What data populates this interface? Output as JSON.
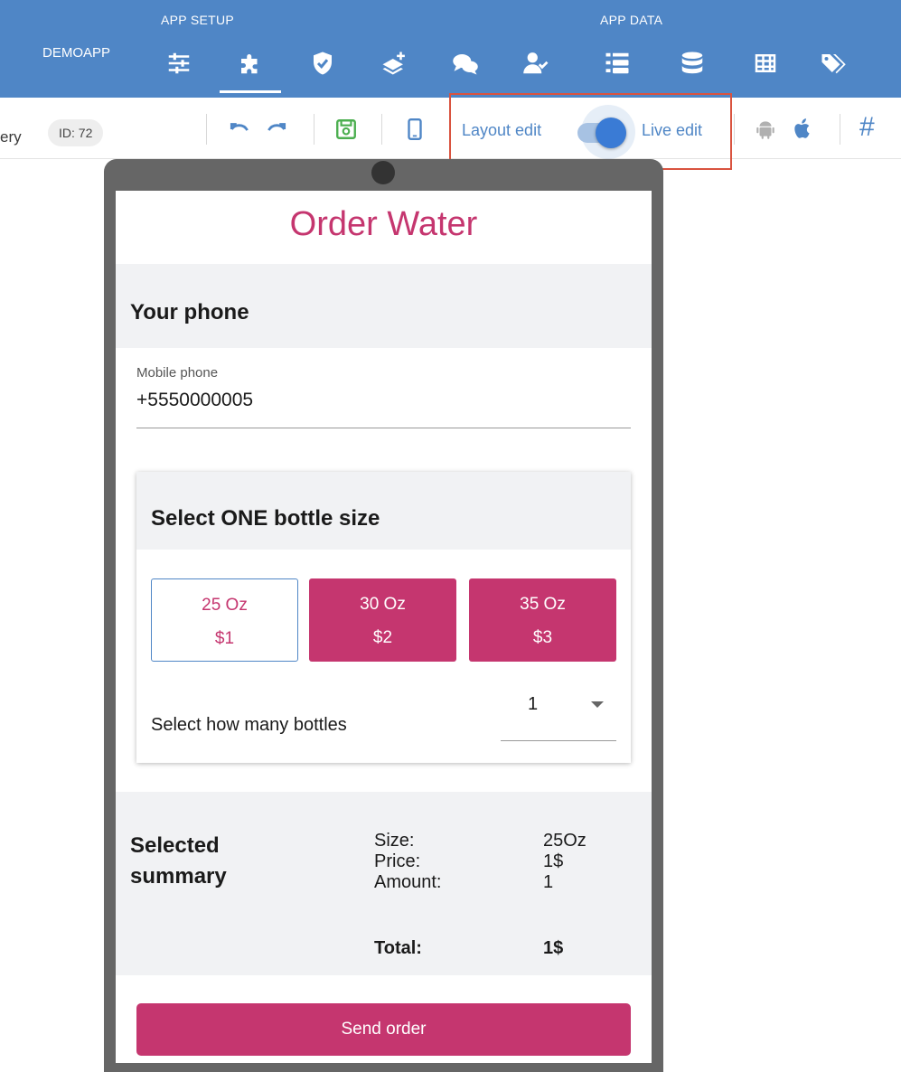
{
  "topbar": {
    "app_name": "DEMOAPP",
    "section_setup": "APP SETUP",
    "section_data": "APP DATA",
    "background_color": "#4f86c6",
    "icons": [
      "sliders-icon",
      "puzzle-icon",
      "shield-check-icon",
      "layers-add-icon",
      "chat-icon",
      "user-check-icon",
      "list-icon",
      "database-icon",
      "table-icon",
      "tags-icon"
    ],
    "active_icon": "puzzle-icon"
  },
  "toolbar": {
    "crumb": "ery",
    "id_badge": "ID: 72",
    "layout_edit_label": "Layout edit",
    "live_edit_label": "Live edit",
    "mode": "Live edit",
    "hash_label": "#",
    "icons": [
      "undo-icon",
      "redo-icon",
      "save-icon",
      "phone-preview-icon",
      "android-icon",
      "apple-icon"
    ]
  },
  "app": {
    "title": "Order Water",
    "accent_color": "#c5366f",
    "phone_section": {
      "heading": "Your phone",
      "field_label": "Mobile phone",
      "field_value": "+5550000005"
    },
    "bottle_card": {
      "heading": "Select ONE bottle size",
      "options": [
        {
          "size": "25 Oz",
          "price": "$1",
          "selected": true
        },
        {
          "size": "30 Oz",
          "price": "$2",
          "selected": false
        },
        {
          "size": "35 Oz",
          "price": "$3",
          "selected": false
        }
      ],
      "quantity_label": "Select how many bottles",
      "quantity_value": "1"
    },
    "summary": {
      "heading": "Selected summary",
      "rows": [
        {
          "label": "Size:",
          "value": "25Oz"
        },
        {
          "label": "Price:",
          "value": "1$"
        },
        {
          "label": "Amount:",
          "value": "1"
        }
      ],
      "total_label": "Total:",
      "total_value": "1$"
    },
    "send_button": "Send order"
  }
}
